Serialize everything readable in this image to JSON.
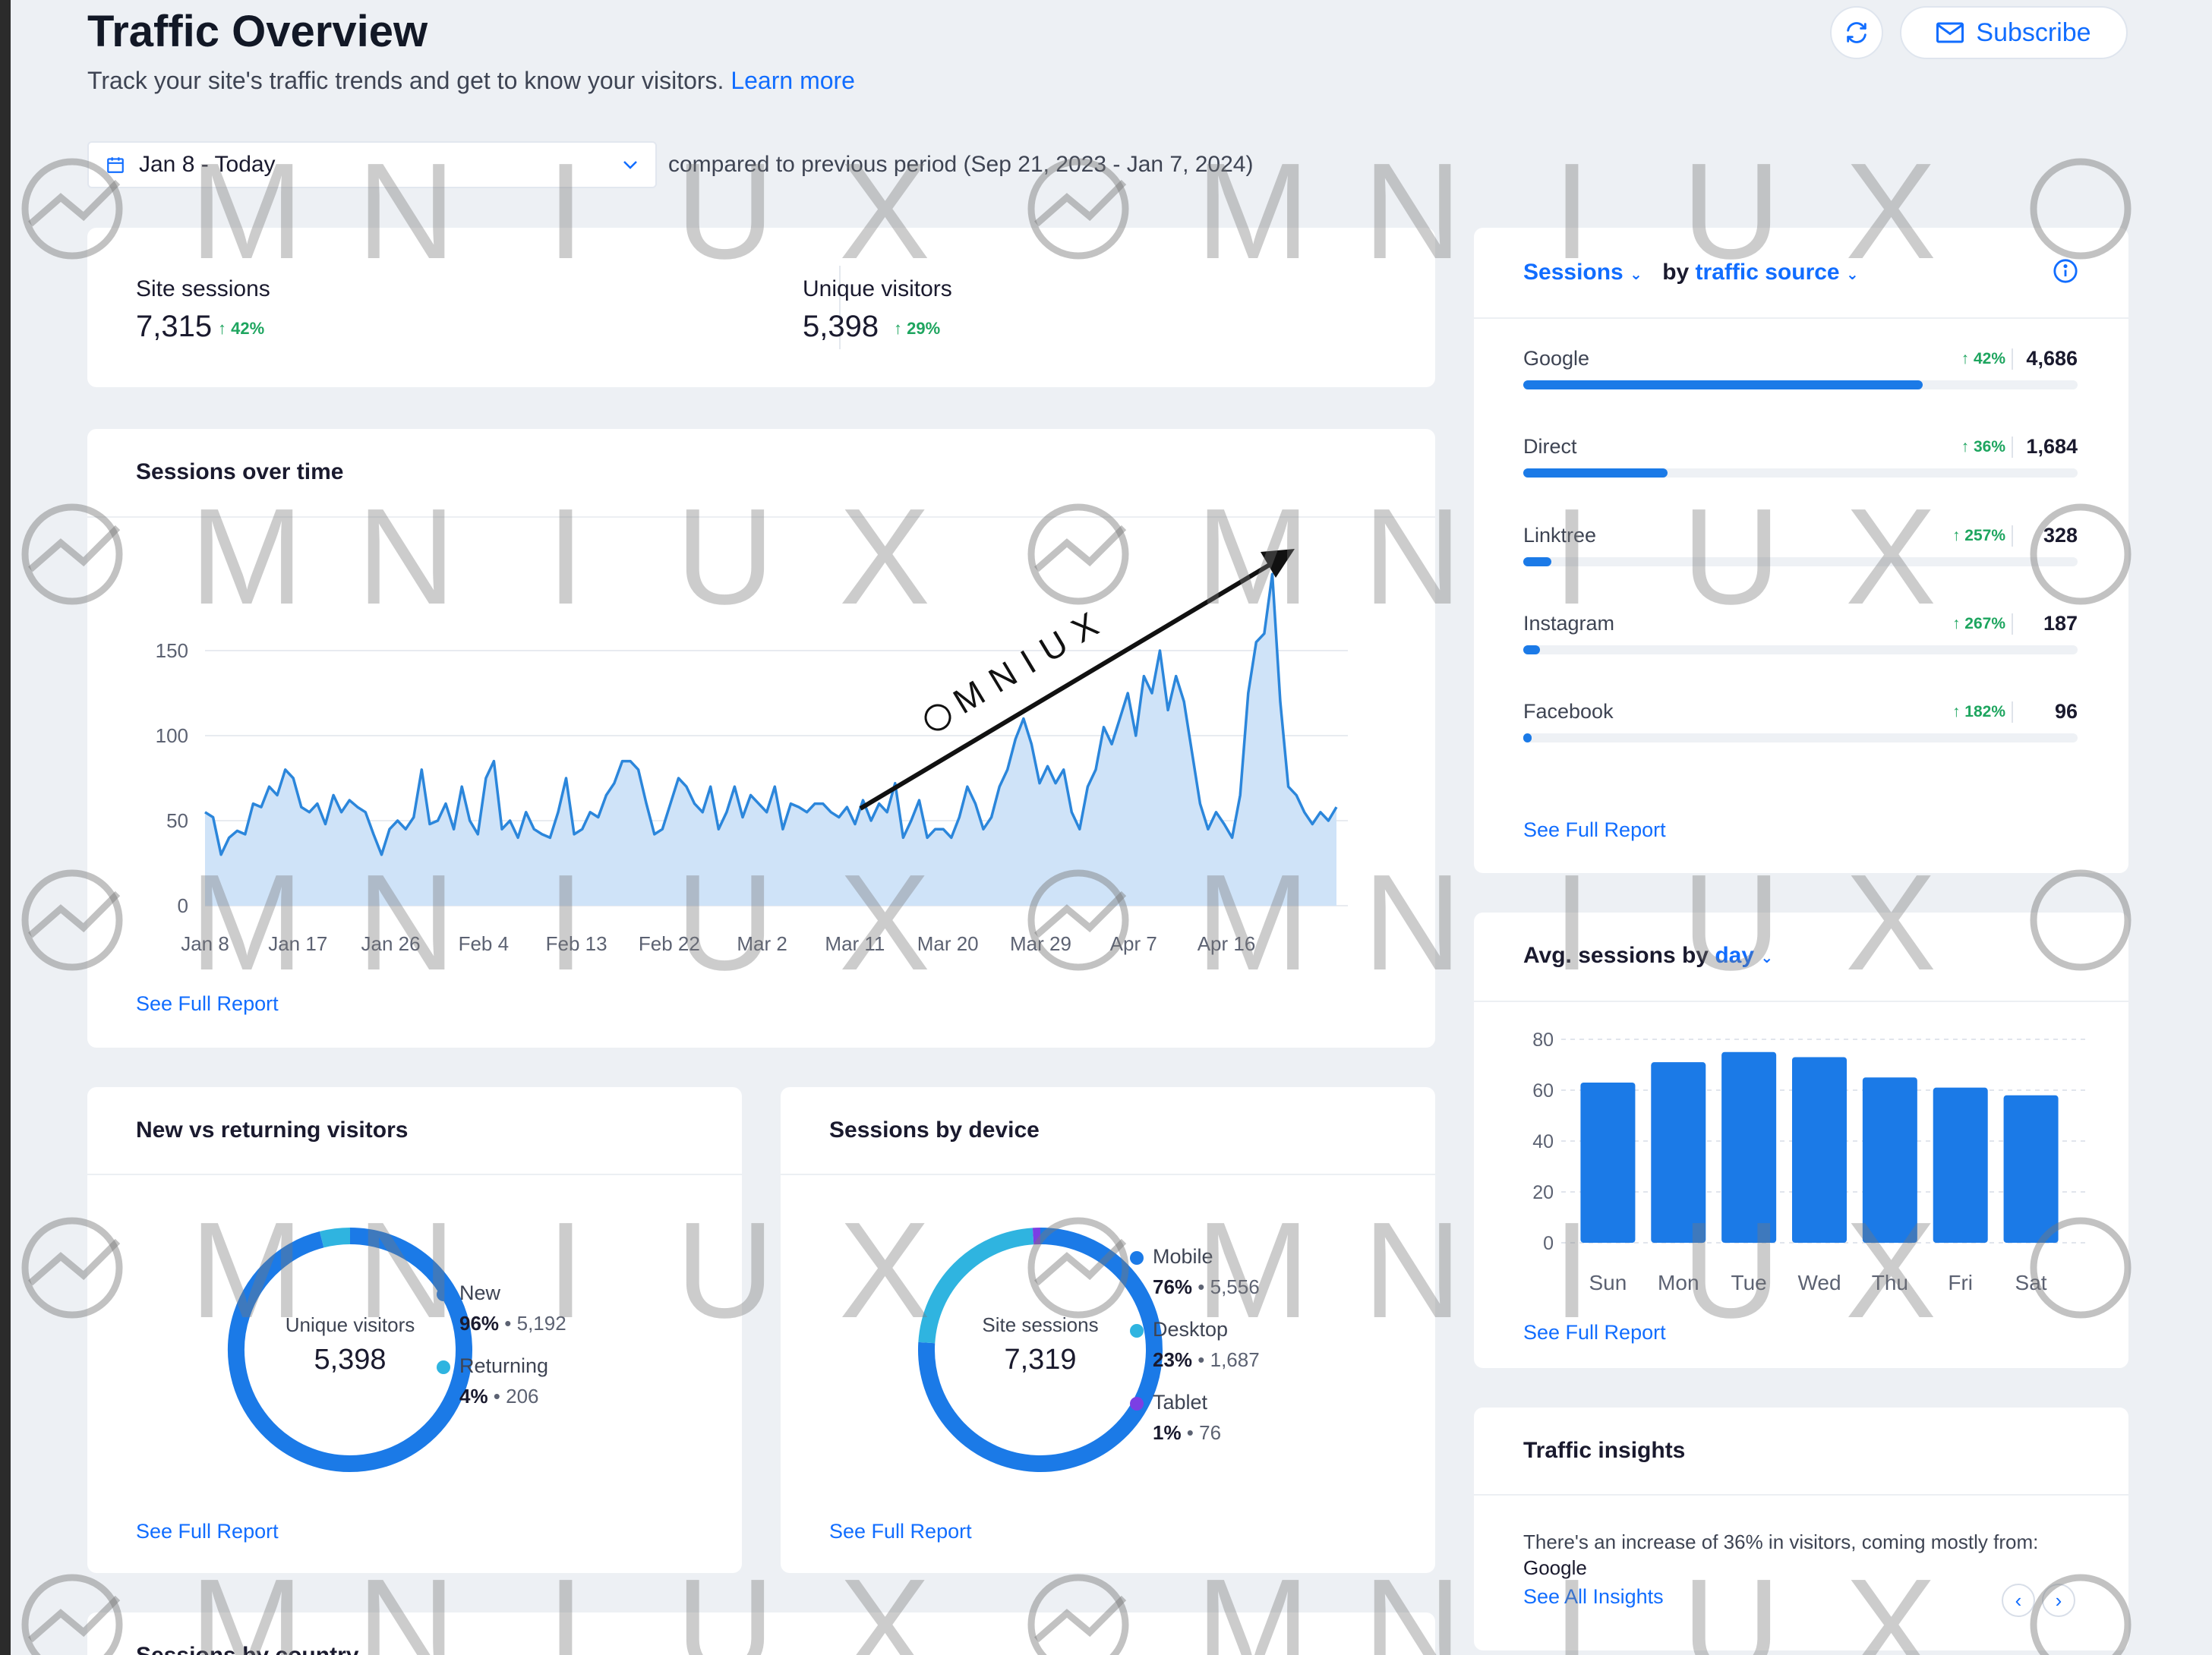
{
  "page": {
    "title": "Traffic Overview",
    "subtitle": "Track your site's traffic trends and get to know your visitors.",
    "learn_more": "Learn more",
    "subscribe_label": "Subscribe",
    "date_range": "Jan 8 - Today",
    "compare_text": "compared to previous period (Sep 21, 2023 - Jan 7, 2024)"
  },
  "kpis": [
    {
      "label": "Site sessions",
      "value": "7,315",
      "change": "42%"
    },
    {
      "label": "Unique visitors",
      "value": "5,398",
      "change": "29%"
    }
  ],
  "sessions_over_time": {
    "title": "Sessions over time",
    "see_full_report": "See Full Report",
    "chart_data": {
      "type": "area",
      "x_tick_labels": [
        "Jan 8",
        "Jan 17",
        "Jan 26",
        "Feb 4",
        "Feb 13",
        "Feb 22",
        "Mar 2",
        "Mar 11",
        "Mar 20",
        "Mar 29",
        "Apr 7",
        "Apr 16"
      ],
      "y_ticks": [
        0,
        50,
        100,
        150
      ],
      "ylim": [
        0,
        200
      ],
      "grid": true,
      "values": [
        55,
        52,
        30,
        40,
        44,
        42,
        60,
        58,
        70,
        65,
        80,
        75,
        58,
        55,
        60,
        48,
        65,
        55,
        62,
        58,
        55,
        42,
        30,
        45,
        50,
        45,
        52,
        80,
        48,
        50,
        60,
        45,
        70,
        50,
        42,
        75,
        85,
        45,
        50,
        40,
        55,
        45,
        42,
        40,
        55,
        75,
        42,
        45,
        55,
        52,
        65,
        72,
        85,
        85,
        80,
        60,
        42,
        45,
        60,
        75,
        70,
        60,
        55,
        70,
        45,
        55,
        70,
        52,
        65,
        60,
        55,
        70,
        45,
        60,
        58,
        55,
        60,
        60,
        55,
        52,
        58,
        48,
        62,
        50,
        60,
        55,
        72,
        40,
        50,
        62,
        40,
        45,
        45,
        40,
        52,
        70,
        60,
        45,
        52,
        70,
        80,
        98,
        110,
        95,
        72,
        82,
        72,
        80,
        55,
        45,
        70,
        80,
        105,
        95,
        110,
        125,
        100,
        135,
        125,
        150,
        115,
        135,
        120,
        90,
        60,
        45,
        55,
        48,
        40,
        65,
        125,
        155,
        160,
        195,
        120,
        70,
        65,
        55,
        48,
        55,
        50,
        58
      ]
    },
    "watermark_text": "MNIUX"
  },
  "traffic_source": {
    "metric_label": "Sessions",
    "by_label": "by",
    "dimension_label": "traffic source",
    "see_full_report": "See Full Report",
    "rows": [
      {
        "name": "Google",
        "change": "42%",
        "value": "4,686",
        "share": 0.72
      },
      {
        "name": "Direct",
        "change": "36%",
        "value": "1,684",
        "share": 0.26
      },
      {
        "name": "Linktree",
        "change": "257%",
        "value": "328",
        "share": 0.05
      },
      {
        "name": "Instagram",
        "change": "267%",
        "value": "187",
        "share": 0.03
      },
      {
        "name": "Facebook",
        "change": "182%",
        "value": "96",
        "share": 0.015
      }
    ]
  },
  "avg_sessions": {
    "title_prefix": "Avg. sessions by",
    "dimension": "day",
    "see_full_report": "See Full Report",
    "chart_data": {
      "type": "bar",
      "categories": [
        "Sun",
        "Mon",
        "Tue",
        "Wed",
        "Thu",
        "Fri",
        "Sat"
      ],
      "values": [
        63,
        71,
        75,
        73,
        65,
        61,
        58
      ],
      "y_ticks": [
        0,
        20,
        40,
        60,
        80
      ],
      "ylim": [
        0,
        80
      ]
    }
  },
  "new_vs_returning": {
    "title": "New vs returning visitors",
    "center_label": "Unique visitors",
    "center_value": "5,398",
    "see_full_report": "See Full Report",
    "chart_data": {
      "type": "pie",
      "segments": [
        {
          "name": "New",
          "percent": "96%",
          "count": "5,192",
          "fraction": 0.96,
          "color": "#1b7ae7"
        },
        {
          "name": "Returning",
          "percent": "4%",
          "count": "206",
          "fraction": 0.04,
          "color": "#2fb4e0"
        }
      ]
    }
  },
  "sessions_by_device": {
    "title": "Sessions by device",
    "center_label": "Site sessions",
    "center_value": "7,319",
    "see_full_report": "See Full Report",
    "chart_data": {
      "type": "pie",
      "segments": [
        {
          "name": "Mobile",
          "percent": "76%",
          "count": "5,556",
          "fraction": 0.76,
          "color": "#1b7ae7"
        },
        {
          "name": "Desktop",
          "percent": "23%",
          "count": "1,687",
          "fraction": 0.23,
          "color": "#2fb4e0"
        },
        {
          "name": "Tablet",
          "percent": "1%",
          "count": "76",
          "fraction": 0.01,
          "color": "#7b3fe4"
        }
      ]
    }
  },
  "traffic_insights": {
    "title": "Traffic insights",
    "text": "There's an increase of 36% in visitors, coming mostly from:",
    "source": "Google",
    "see_all": "See All Insights"
  },
  "bottom": {
    "partial_title": "Sessions by country"
  },
  "colors": {
    "accent": "#116dff",
    "bar": "#1b7ae7",
    "positive": "#1ea55f",
    "area_fill": "#cfe3f8",
    "line": "#2b86db"
  }
}
